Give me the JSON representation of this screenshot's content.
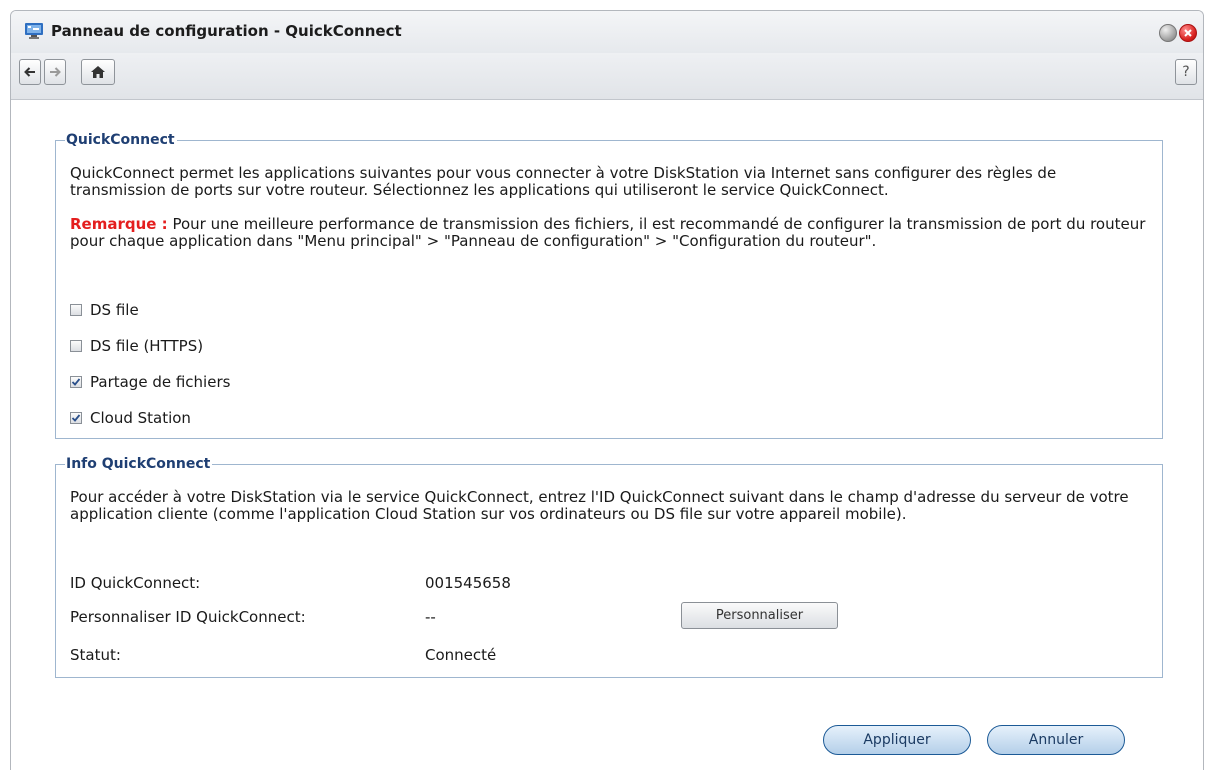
{
  "window": {
    "title": "Panneau de configuration - QuickConnect",
    "help_label": "?"
  },
  "quickconnect": {
    "legend": "QuickConnect",
    "description": "QuickConnect permet les applications suivantes pour vous connecter à votre DiskStation via Internet sans configurer des règles de transmission de ports sur votre routeur. Sélectionnez les applications qui utiliseront le service QuickConnect.",
    "remark_label": "Remarque :",
    "remark_text": " Pour une meilleure performance de transmission des fichiers, il est recommandé de configurer la transmission de port du routeur pour chaque application dans \"Menu principal\" > \"Panneau de configuration\" > \"Configuration du routeur\".",
    "apps": [
      {
        "label": "DS file",
        "checked": false
      },
      {
        "label": "DS file (HTTPS)",
        "checked": false
      },
      {
        "label": "Partage de fichiers",
        "checked": true
      },
      {
        "label": "Cloud Station",
        "checked": true
      }
    ]
  },
  "info": {
    "legend": "Info QuickConnect",
    "description": "Pour accéder à votre DiskStation via le service QuickConnect, entrez l'ID QuickConnect suivant dans le champ d'adresse du serveur de votre application cliente (comme l'application Cloud Station sur vos ordinateurs ou DS file sur votre appareil mobile).",
    "id_label": "ID QuickConnect:",
    "id_value": "001545658",
    "custom_label": "Personnaliser ID QuickConnect:",
    "custom_value": "--",
    "custom_button": "Personnaliser",
    "status_label": "Statut:",
    "status_value": "Connecté"
  },
  "actions": {
    "apply": "Appliquer",
    "cancel": "Annuler"
  },
  "colors": {
    "legend": "#1f3f73",
    "remark": "#e41e1e",
    "border": "#9fb6cf",
    "primary_button": "#b4cfe9"
  },
  "icons": [
    "control-panel-icon",
    "minimize-icon",
    "close-icon",
    "back-arrow-icon",
    "forward-arrow-icon",
    "home-icon",
    "help-icon",
    "checkbox-checked-icon",
    "checkbox-unchecked-icon"
  ]
}
